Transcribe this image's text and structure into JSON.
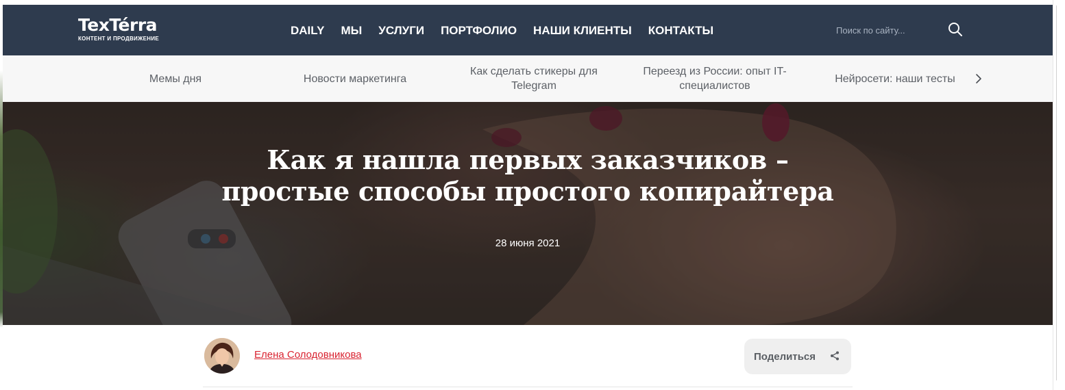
{
  "header": {
    "logo": {
      "name": "TexTérra",
      "tagline": "КОНТЕНТ И ПРОДВИЖЕНИЕ"
    },
    "nav": [
      {
        "label": "DAILY"
      },
      {
        "label": "МЫ"
      },
      {
        "label": "УСЛУГИ"
      },
      {
        "label": "ПОРТФОЛИО"
      },
      {
        "label": "НАШИ КЛИЕНТЫ"
      },
      {
        "label": "КОНТАКТЫ"
      }
    ],
    "search": {
      "placeholder": "Поиск по сайту...",
      "icon": "search-icon"
    }
  },
  "topics": {
    "items": [
      {
        "label": "Мемы дня"
      },
      {
        "label": "Новости маркетинга"
      },
      {
        "label": "Как сделать стикеры для Telegram"
      },
      {
        "label": "Переезд из России: опыт IT-специалистов"
      },
      {
        "label": "Нейросети: наши тесты"
      }
    ],
    "next_icon": "chevron-right-icon"
  },
  "hero": {
    "title_line1": "Как я нашла первых заказчиков –",
    "title_line2": "простые способы простого копирайтера",
    "date": "28 июня 2021"
  },
  "author": {
    "name": "Елена Солодовникова",
    "avatar_icon": "avatar"
  },
  "share": {
    "label": "Поделиться",
    "icon": "share-icon"
  },
  "colors": {
    "header_bg": "#2e3b4e",
    "topics_bg": "#f7f7f7",
    "link_red": "#d92330",
    "share_bg": "#efefef"
  }
}
